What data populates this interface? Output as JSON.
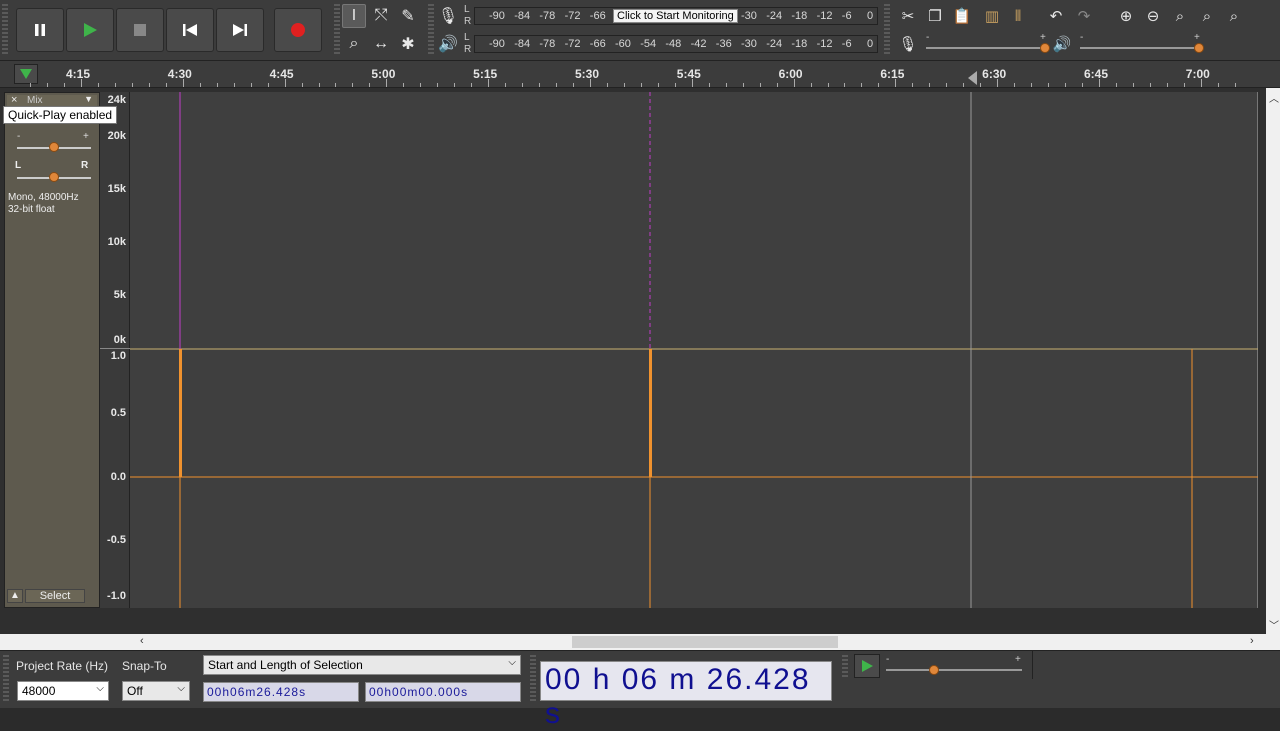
{
  "colors": {
    "accent": "#f0922e",
    "playhead_red": "#c0304a",
    "selection_line": "#c13cc8",
    "play_green": "#3fb44a",
    "record_red": "#e02020"
  },
  "transport": {
    "pause_icon": "pause-icon",
    "play_icon": "play-icon",
    "stop_icon": "stop-icon",
    "skip_start_icon": "skip-to-start-icon",
    "skip_end_icon": "skip-to-end-icon",
    "record_icon": "record-icon"
  },
  "meters": {
    "record_ticks": [
      "-90",
      "-84",
      "-78",
      "-72",
      "-66",
      "-30",
      "-24",
      "-18",
      "-12",
      "-6",
      "0"
    ],
    "record_monitor_text": "Click to Start Monitoring",
    "play_ticks": [
      "-90",
      "-84",
      "-78",
      "-72",
      "-66",
      "-60",
      "-54",
      "-48",
      "-42",
      "-36",
      "-30",
      "-24",
      "-18",
      "-12",
      "-6",
      "0"
    ],
    "l_label": "L",
    "r_label": "R"
  },
  "mixer": {
    "minus": "-",
    "plus": "+"
  },
  "ruler": {
    "labels": [
      "4:15",
      "4:30",
      "4:45",
      "5:00",
      "5:15",
      "5:30",
      "5:45",
      "6:00",
      "6:15",
      "6:30",
      "6:45",
      "7:00"
    ]
  },
  "track": {
    "close_label": "×",
    "name": "Mix",
    "gain_minus": "-",
    "gain_plus": "+",
    "pan_l": "L",
    "pan_r": "R",
    "info_line1": "Mono, 48000Hz",
    "info_line2": "32-bit float",
    "select_label": "Select",
    "tooltip": "Quick-Play enabled",
    "gain_fraction": 0.5,
    "pan_fraction": 0.5
  },
  "vscale": {
    "spectral": [
      "24k",
      "20k",
      "15k",
      "10k",
      "5k",
      "0k"
    ],
    "waveform": [
      "1.0",
      "0.5",
      "0.0",
      "-0.5",
      "-1.0"
    ]
  },
  "bottom": {
    "project_rate_label": "Project Rate (Hz)",
    "project_rate_value": "48000",
    "snap_to_label": "Snap-To",
    "snap_to_value": "Off",
    "selection_mode": "Start and Length of Selection",
    "selection_start": "00h06m26.428s",
    "selection_length": "00h00m00.000s",
    "big_time": "00 h 06 m 26.428 s",
    "play_speed_minus": "-",
    "play_speed_plus": "+",
    "play_speed_fraction": 0.35
  }
}
